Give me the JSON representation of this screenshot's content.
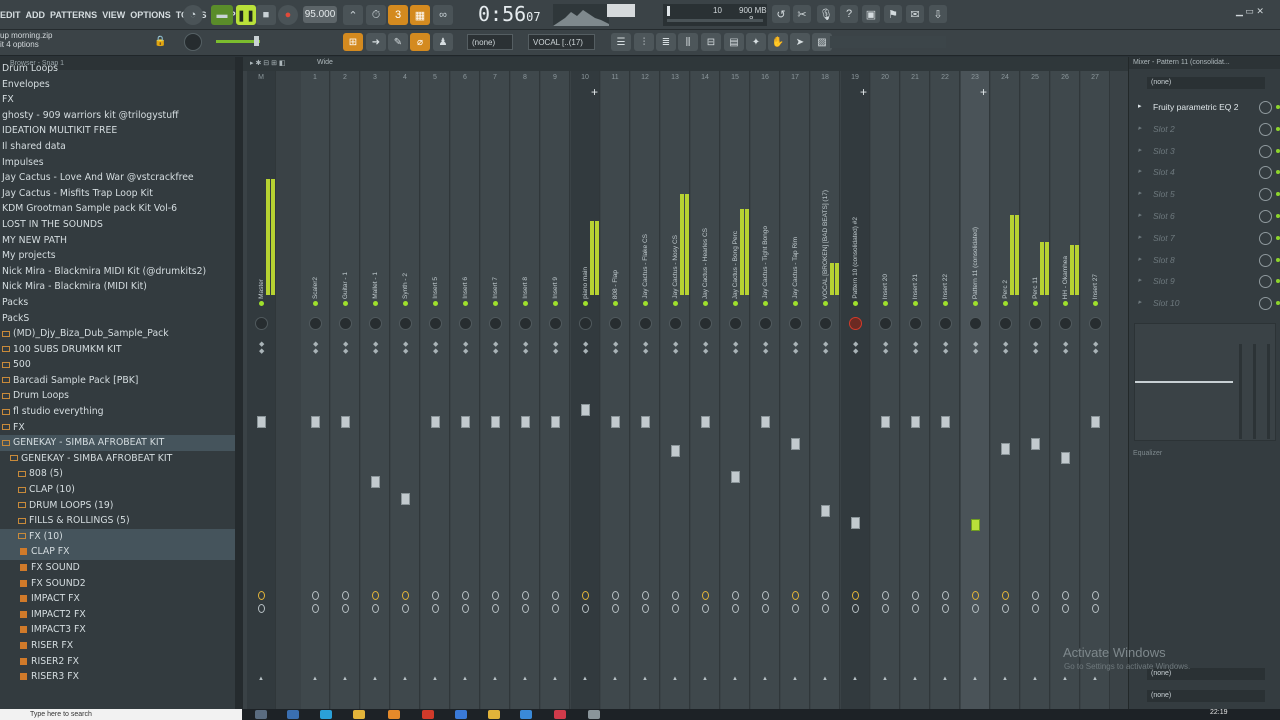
{
  "menu": [
    "EDIT",
    "ADD",
    "PATTERNS",
    "VIEW",
    "OPTIONS",
    "TOOLS",
    "HELP"
  ],
  "transport": {
    "tempo": "95.000",
    "time": "0:56",
    "time_frac": "07",
    "meter_top": "10",
    "meter_mid": "900 MB",
    "meter_bot": "8"
  },
  "project": {
    "name": "up morning.zip",
    "options": "it 4 options"
  },
  "toolbar2": {
    "pattern_none": "(none)",
    "channel": "VOCAL [..(17)"
  },
  "browser": {
    "header": "Browser - Snap 1",
    "items": [
      {
        "label": "Drum Loops",
        "type": "item"
      },
      {
        "label": "Envelopes",
        "type": "item"
      },
      {
        "label": "FX",
        "type": "item"
      },
      {
        "label": "ghosty - 909 warriors kit @trilogystuff",
        "type": "item"
      },
      {
        "label": "IDEATION MULTIKIT FREE",
        "type": "item"
      },
      {
        "label": "Il shared data",
        "type": "item"
      },
      {
        "label": "Impulses",
        "type": "item"
      },
      {
        "label": "Jay Cactus - Love And War @vstcrackfree",
        "type": "item"
      },
      {
        "label": "Jay Cactus - Misfits Trap Loop Kit",
        "type": "item"
      },
      {
        "label": "KDM Grootman Sample pack Kit Vol-6",
        "type": "item"
      },
      {
        "label": "LOST IN THE SOUNDS",
        "type": "item"
      },
      {
        "label": "MY NEW PATH",
        "type": "item"
      },
      {
        "label": "My projects",
        "type": "item"
      },
      {
        "label": "Nick Mira - Blackmira MIDI Kit (@drumkits2)",
        "type": "item"
      },
      {
        "label": "Nick Mira - Blackmira (MIDI Kit)",
        "type": "item"
      },
      {
        "label": "Packs",
        "type": "item"
      },
      {
        "label": "PackS",
        "type": "item"
      },
      {
        "label": "(MD)_Djy_Biza_Dub_Sample_Pack",
        "type": "folder"
      },
      {
        "label": "100 SUBS DRUMKM KIT",
        "type": "folder"
      },
      {
        "label": "500",
        "type": "folder"
      },
      {
        "label": "Barcadi Sample Pack [PBK]",
        "type": "folder"
      },
      {
        "label": "Drum Loops",
        "type": "folder"
      },
      {
        "label": "fl studio everything",
        "type": "folder"
      },
      {
        "label": "FX",
        "type": "folder"
      },
      {
        "label": "GENEKAY - SIMBA AFROBEAT KIT",
        "type": "folder",
        "sel": true
      },
      {
        "label": "GENEKAY - SIMBA AFROBEAT KIT",
        "type": "folder2"
      },
      {
        "label": "808 (5)",
        "type": "folder3"
      },
      {
        "label": "CLAP (10)",
        "type": "folder3"
      },
      {
        "label": "DRUM LOOPS (19)",
        "type": "folder3"
      },
      {
        "label": "FILLS & ROLLINGS (5)",
        "type": "folder3"
      },
      {
        "label": "FX (10)",
        "type": "folder3",
        "sel": true
      },
      {
        "label": "CLAP FX",
        "type": "file",
        "sel": true
      },
      {
        "label": "FX SOUND",
        "type": "file"
      },
      {
        "label": "FX SOUND2",
        "type": "file"
      },
      {
        "label": "IMPACT FX",
        "type": "file"
      },
      {
        "label": "IMPACT2 FX",
        "type": "file"
      },
      {
        "label": "IMPACT3 FX",
        "type": "file"
      },
      {
        "label": "RISER FX",
        "type": "file"
      },
      {
        "label": "RISER2 FX",
        "type": "file"
      },
      {
        "label": "RISER3 FX",
        "type": "file"
      }
    ]
  },
  "mixer": {
    "header": "Wide",
    "strips": [
      {
        "num": "M",
        "name": "Master",
        "lvl": 0.55,
        "fader": 0.18,
        "send": "y"
      },
      {
        "num": "1",
        "name": "Scaler2",
        "lvl": 0,
        "fader": 0.18,
        "send": "n"
      },
      {
        "num": "2",
        "name": "Guitar - 1",
        "lvl": 0,
        "fader": 0.18,
        "send": "n"
      },
      {
        "num": "3",
        "name": "Mallet - 1",
        "lvl": 0,
        "fader": 0.43,
        "send": "y"
      },
      {
        "num": "4",
        "name": "Synth - 2",
        "lvl": 0,
        "fader": 0.5,
        "send": "y"
      },
      {
        "num": "5",
        "name": "Insert 5",
        "lvl": 0,
        "fader": 0.18,
        "send": "n"
      },
      {
        "num": "6",
        "name": "Insert 6",
        "lvl": 0,
        "fader": 0.18,
        "send": "n"
      },
      {
        "num": "7",
        "name": "Insert 7",
        "lvl": 0,
        "fader": 0.18,
        "send": "n"
      },
      {
        "num": "8",
        "name": "Insert 8",
        "lvl": 0,
        "fader": 0.18,
        "send": "n"
      },
      {
        "num": "9",
        "name": "Insert 9",
        "lvl": 0,
        "fader": 0.18,
        "send": "n"
      },
      {
        "num": "10",
        "name": "piano main",
        "lvl": 0.35,
        "fader": 0.13,
        "send": "y"
      },
      {
        "num": "11",
        "name": "808 - Flap",
        "lvl": 0,
        "fader": 0.18,
        "send": "n"
      },
      {
        "num": "12",
        "name": "Jay Cactus - Flake CS",
        "lvl": 0,
        "fader": 0.18,
        "send": "n"
      },
      {
        "num": "13",
        "name": "Jay Cactus - Nosy CS",
        "lvl": 0.48,
        "fader": 0.3,
        "send": "n"
      },
      {
        "num": "14",
        "name": "Jay Cactus - Hearles CS",
        "lvl": 0,
        "fader": 0.18,
        "send": "y"
      },
      {
        "num": "15",
        "name": "Jay Cactus - Bong Perc",
        "lvl": 0.41,
        "fader": 0.41,
        "send": "n"
      },
      {
        "num": "16",
        "name": "Jay Cactus - Tight Bongo",
        "lvl": 0,
        "fader": 0.18,
        "send": "n"
      },
      {
        "num": "17",
        "name": "Jay Cactus - Tap Rim",
        "lvl": 0,
        "fader": 0.27,
        "send": "y"
      },
      {
        "num": "18",
        "name": "VOCAL [BROKEN] [BAD BEATS] (17)",
        "lvl": 0.15,
        "fader": 0.55,
        "send": "n"
      },
      {
        "num": "19",
        "name": "Pattern 10 (consolidated) #2",
        "lvl": 0,
        "fader": 0.6,
        "send": "y"
      },
      {
        "num": "20",
        "name": "Insert 20",
        "lvl": 0,
        "fader": 0.18,
        "send": "n"
      },
      {
        "num": "21",
        "name": "Insert 21",
        "lvl": 0,
        "fader": 0.18,
        "send": "n"
      },
      {
        "num": "22",
        "name": "Insert 22",
        "lvl": 0,
        "fader": 0.18,
        "send": "n"
      },
      {
        "num": "23",
        "name": "Pattern 11 (consolidated)",
        "lvl": 0,
        "fader": 0.61,
        "send": "y"
      },
      {
        "num": "24",
        "name": "Perc 2",
        "lvl": 0.38,
        "fader": 0.29,
        "send": "y"
      },
      {
        "num": "25",
        "name": "Perc 11",
        "lvl": 0.25,
        "fader": 0.27,
        "send": "n"
      },
      {
        "num": "26",
        "name": "HH - Okamhea",
        "lvl": 0.24,
        "fader": 0.33,
        "send": "n"
      },
      {
        "num": "27",
        "name": "Insert 27",
        "lvl": 0,
        "fader": 0.18,
        "send": "n"
      }
    ]
  },
  "fxpanel": {
    "title": "Mixer - Pattern 11 (consolidat...",
    "input": "(none)",
    "slots": [
      "Fruity parametric EQ 2",
      "Slot 2",
      "Slot 3",
      "Slot 4",
      "Slot 5",
      "Slot 6",
      "Slot 7",
      "Slot 8",
      "Slot 9",
      "Slot 10"
    ],
    "eq_label": "Equalizer",
    "out1": "(none)",
    "out2": "(none)"
  },
  "watermark": {
    "line1": "Activate Windows",
    "line2": "Go to Settings to activate Windows."
  },
  "taskbar": {
    "search": "Type here to search",
    "time": "22:19"
  }
}
